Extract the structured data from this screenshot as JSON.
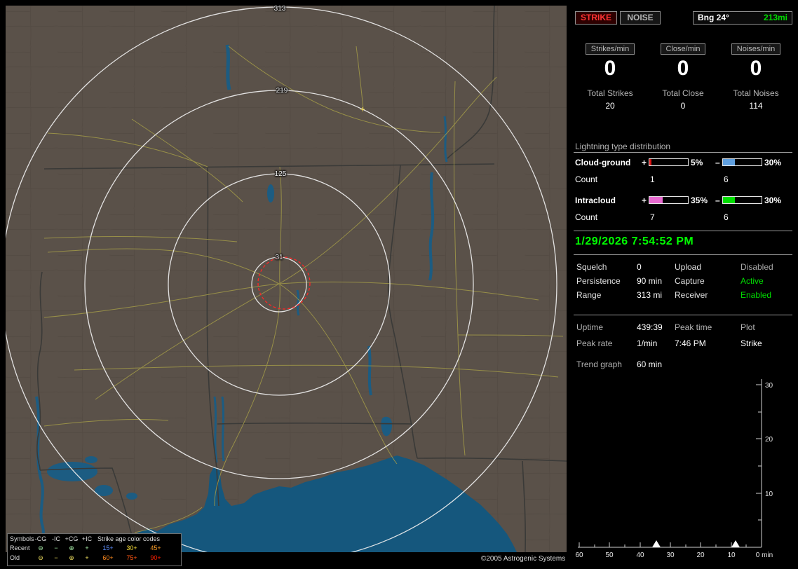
{
  "map": {
    "rings": [
      "313",
      "219",
      "125",
      "31"
    ],
    "plus_marker": "+",
    "legend": {
      "symbols_title": "Symbols",
      "col_headers": [
        "-CG",
        "-IC",
        "+CG",
        "+IC"
      ],
      "age_title": "Strike age color codes",
      "recent_label": "Recent",
      "old_label": "Old",
      "symbols": [
        "⊖",
        "−",
        "⊕",
        "+"
      ],
      "recent_ages": [
        "15+",
        "30+",
        "45+"
      ],
      "old_ages": [
        "60+",
        "75+",
        "90+"
      ]
    },
    "copyright": "©2005 Astrogenic Systems"
  },
  "panel": {
    "strike_button": "STRIKE",
    "noise_button": "NOISE",
    "bearing_label": "Bng 24°",
    "bearing_distance": "213mi",
    "rate_boxes": [
      {
        "label": "Strikes/min",
        "value": "0",
        "total_label": "Total Strikes",
        "total_value": "20"
      },
      {
        "label": "Close/min",
        "value": "0",
        "total_label": "Total Close",
        "total_value": "0"
      },
      {
        "label": "Noises/min",
        "value": "0",
        "total_label": "Total Noises",
        "total_value": "114"
      }
    ],
    "distribution": {
      "title": "Lightning type distribution",
      "count_label": "Count",
      "plus_sign": "+",
      "minus_sign": "–",
      "rows": [
        {
          "label": "Cloud-ground",
          "plus_pct": "5%",
          "minus_pct": "30%",
          "plus_count": "1",
          "minus_count": "6",
          "plus_fill": 5,
          "minus_fill": 30,
          "plus_color": "#dd1111",
          "minus_color": "#5f9fdf"
        },
        {
          "label": "Intracloud",
          "plus_pct": "35%",
          "minus_pct": "30%",
          "plus_count": "7",
          "minus_count": "6",
          "plus_fill": 35,
          "minus_fill": 30,
          "plus_color": "#e86ad0",
          "minus_color": "#00dd00"
        }
      ]
    },
    "datetime": "1/29/2026 7:54:52 PM",
    "settings": {
      "left": [
        {
          "label": "Squelch",
          "value": "0"
        },
        {
          "label": "Persistence",
          "value": "90 min"
        },
        {
          "label": "Range",
          "value": "313 mi"
        }
      ],
      "right": [
        {
          "label": "Upload",
          "value": "Disabled"
        },
        {
          "label": "Capture",
          "value": "Active"
        },
        {
          "label": "Receiver",
          "value": "Enabled"
        }
      ]
    },
    "stats": {
      "uptime_label": "Uptime",
      "uptime_value": "439:39",
      "peaktime_label": "Peak time",
      "peaktime_value": "7:46 PM",
      "plot_label": "Plot",
      "plot_value": "Strike",
      "peakrate_label": "Peak rate",
      "peakrate_value": "1/min",
      "trend_label": "Trend graph",
      "trend_value": "60 min"
    }
  },
  "colors": {
    "accent_green": "#00ff00",
    "strike_red": "#ff3333",
    "map_land": "#5a5149",
    "map_water": "#15577d",
    "range_ring": "#eeeeee",
    "alarm_circle": "#ff2626"
  },
  "chart_data": {
    "type": "line",
    "title": "Trend graph",
    "window": "60 min",
    "xlabel": "min",
    "x_tick_labels": [
      "60",
      "50",
      "40",
      "30",
      "20",
      "10",
      "0 min"
    ],
    "y_tick_labels": [
      "30",
      "20",
      "10"
    ],
    "xlim": [
      60,
      0
    ],
    "ylim": [
      0,
      30
    ],
    "series": [
      {
        "name": "Strike",
        "points": [
          {
            "minutes_ago": 35,
            "value": 1
          },
          {
            "minutes_ago": 9,
            "value": 1
          }
        ]
      }
    ]
  }
}
